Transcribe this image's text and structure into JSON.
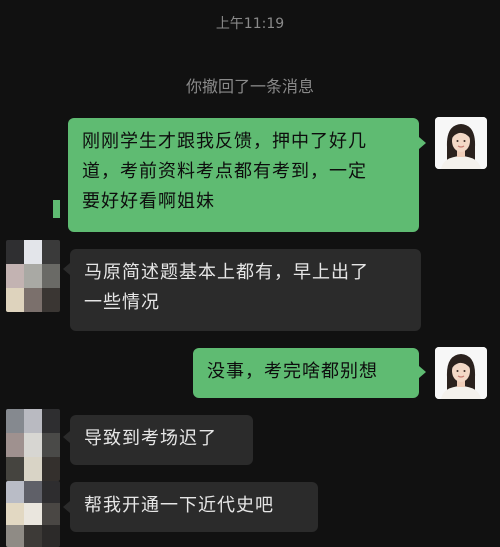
{
  "header": {
    "timestamp": "上午11:19",
    "recall_notice": "你撤回了一条消息"
  },
  "colors": {
    "background": "#111111",
    "self_bubble": "#5fbb72",
    "other_bubble": "#2b2b2b",
    "system_text": "#8a8a8a"
  },
  "messages": [
    {
      "sender": "self",
      "lines": [
        "刚刚学生才跟我反馈，押中了好几",
        "道，考前资料考点都有考到，一定",
        "要好好看啊姐妹"
      ]
    },
    {
      "sender": "other",
      "lines": [
        "马原简述题基本上都有，早上出了",
        "一些情况"
      ]
    },
    {
      "sender": "self",
      "lines": [
        "没事，考完啥都别想"
      ]
    },
    {
      "sender": "other",
      "lines": [
        "导致到考场迟了"
      ]
    },
    {
      "sender": "other",
      "lines": [
        "帮我开通一下近代史吧"
      ]
    }
  ],
  "avatars": {
    "self": "woman-portrait-avatar",
    "other": "pixelated-avatar"
  }
}
